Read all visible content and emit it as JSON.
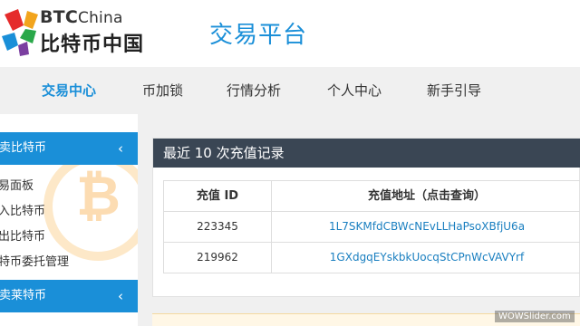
{
  "header": {
    "brand_btc": "BTC",
    "brand_china": "China",
    "brand_cn": "比特币中国",
    "platform_title": "交易平台"
  },
  "nav": {
    "items": [
      "交易中心",
      "币加锁",
      "行情分析",
      "个人中心",
      "新手引导"
    ],
    "active_index": 0
  },
  "sidebar": {
    "section1": {
      "title": "卖比特币",
      "chevron": "‹"
    },
    "items": [
      "易面板",
      "入比特币",
      "出比特币",
      "特币委托管理"
    ],
    "section2": {
      "title": "卖莱特币",
      "chevron": "‹"
    }
  },
  "deposits": {
    "title": "最近 10 次充值记录",
    "columns": [
      "充值 ID",
      "充值地址（点击查询）"
    ],
    "rows": [
      {
        "id": "223345",
        "address": "1L7SKMfdCBWcNEvLLHaPsoXBfjU6a"
      },
      {
        "id": "219962",
        "address": "1GXdgqEYskbkUocqStCPnWcVAVYrf"
      }
    ]
  },
  "watermark": "WOWSlider.com",
  "colors": {
    "accent": "#1a8fd8",
    "panel_header": "#3a4654",
    "nav_bg": "#f0f0f0",
    "link": "#1a7fc0"
  },
  "icons": {
    "logo": "btcchina-logo",
    "background": "bitcoin-coin-icon"
  }
}
